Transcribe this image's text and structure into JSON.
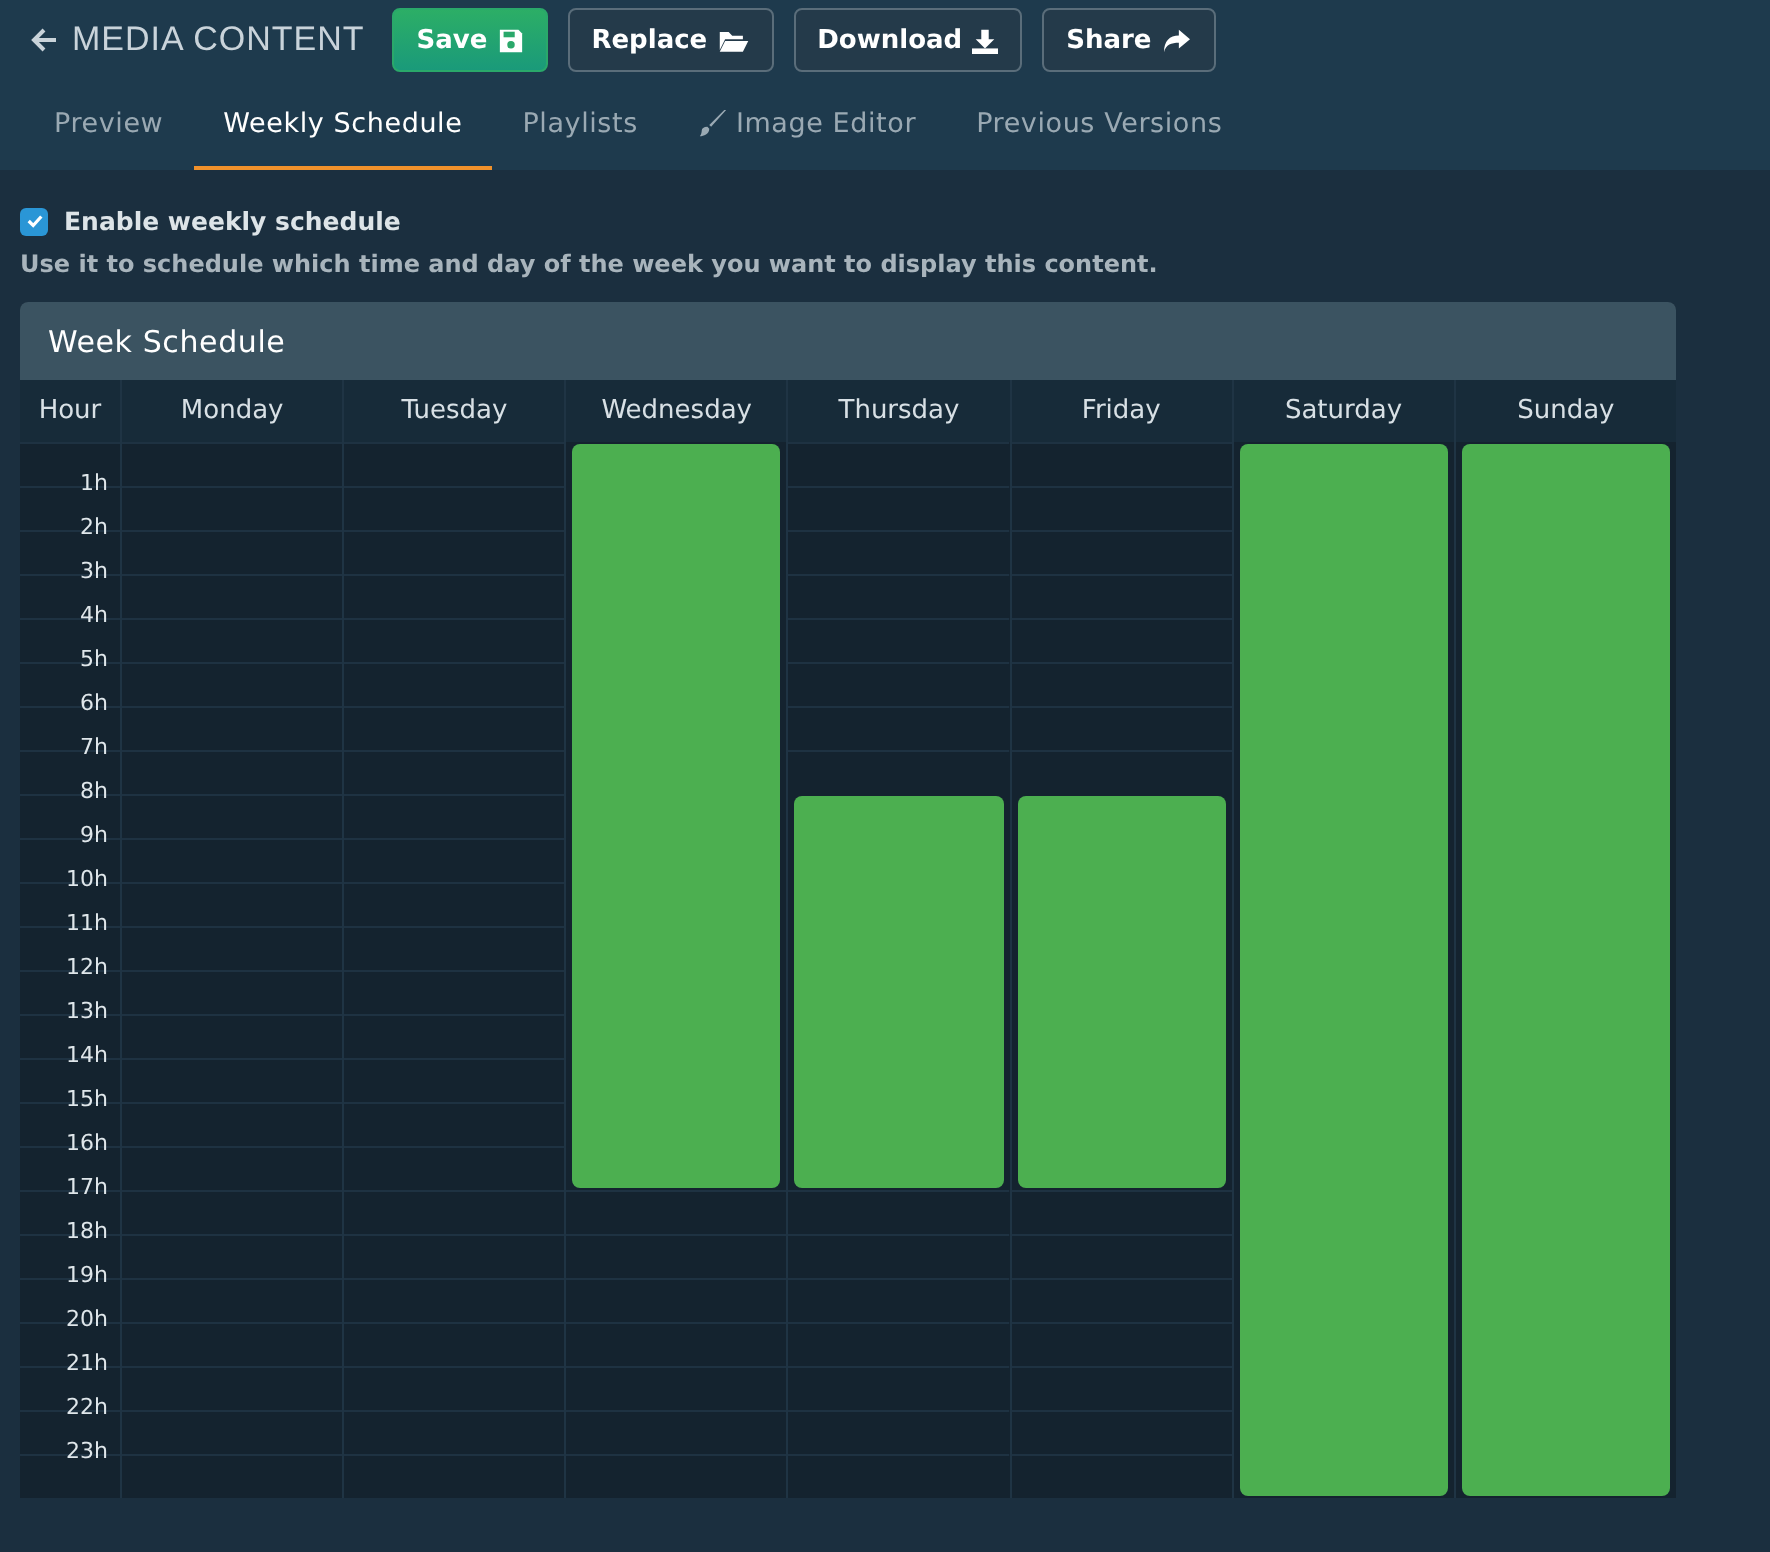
{
  "header": {
    "title": "MEDIA CONTENT",
    "buttons": [
      {
        "label": "Save",
        "kind": "primary"
      },
      {
        "label": "Replace",
        "kind": "default"
      },
      {
        "label": "Download",
        "kind": "default"
      },
      {
        "label": "Share",
        "kind": "default"
      }
    ]
  },
  "tabs": [
    {
      "label": "Preview",
      "selected": false
    },
    {
      "label": "Weekly Schedule",
      "selected": true
    },
    {
      "label": "Playlists",
      "selected": false
    },
    {
      "label": "Image Editor",
      "selected": false
    },
    {
      "label": "Previous Versions",
      "selected": false
    }
  ],
  "enable": {
    "label": "Enable weekly schedule",
    "checked": true
  },
  "description": "Use it to schedule which time and day of the week you want to display this content.",
  "schedule": {
    "title": "Week Schedule",
    "hour_heading": "Hour",
    "hours": [
      "1h",
      "2h",
      "3h",
      "4h",
      "5h",
      "6h",
      "7h",
      "8h",
      "9h",
      "10h",
      "11h",
      "12h",
      "13h",
      "14h",
      "15h",
      "16h",
      "17h",
      "18h",
      "19h",
      "20h",
      "21h",
      "22h",
      "23h"
    ],
    "days": [
      {
        "name": "Monday",
        "hours": [
          false,
          false,
          false,
          false,
          false,
          false,
          false,
          false,
          false,
          false,
          false,
          false,
          false,
          false,
          false,
          false,
          false,
          false,
          false,
          false,
          false,
          false,
          false,
          false
        ]
      },
      {
        "name": "Tuesday",
        "hours": [
          false,
          false,
          false,
          false,
          false,
          false,
          false,
          false,
          false,
          false,
          false,
          false,
          false,
          false,
          false,
          false,
          false,
          false,
          false,
          false,
          false,
          false,
          false,
          false
        ]
      },
      {
        "name": "Wednesday",
        "hours": [
          true,
          true,
          true,
          true,
          true,
          true,
          true,
          true,
          true,
          true,
          true,
          true,
          true,
          true,
          true,
          true,
          true,
          false,
          false,
          false,
          false,
          false,
          false,
          false
        ]
      },
      {
        "name": "Thursday",
        "hours": [
          false,
          false,
          false,
          false,
          false,
          false,
          false,
          false,
          true,
          true,
          true,
          true,
          true,
          true,
          true,
          true,
          true,
          false,
          false,
          false,
          false,
          false,
          false,
          false
        ]
      },
      {
        "name": "Friday",
        "hours": [
          false,
          false,
          false,
          false,
          false,
          false,
          false,
          false,
          true,
          true,
          true,
          true,
          true,
          true,
          true,
          true,
          true,
          false,
          false,
          false,
          false,
          false,
          false,
          false
        ]
      },
      {
        "name": "Saturday",
        "hours": [
          true,
          true,
          true,
          true,
          true,
          true,
          true,
          true,
          true,
          true,
          true,
          true,
          true,
          true,
          true,
          true,
          true,
          true,
          true,
          true,
          true,
          true,
          true,
          true
        ]
      },
      {
        "name": "Sunday",
        "hours": [
          true,
          true,
          true,
          true,
          true,
          true,
          true,
          true,
          true,
          true,
          true,
          true,
          true,
          true,
          true,
          true,
          true,
          true,
          true,
          true,
          true,
          true,
          true,
          true
        ]
      }
    ]
  }
}
